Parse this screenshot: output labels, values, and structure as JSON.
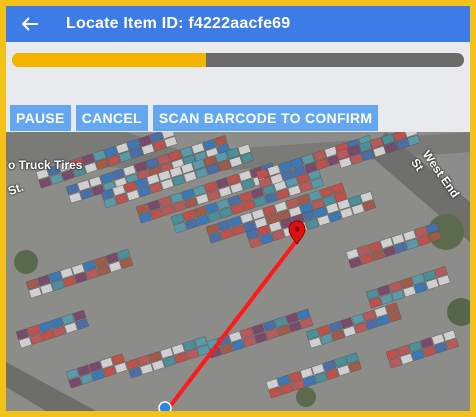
{
  "header": {
    "back_icon": "arrow-left-icon",
    "title": "Locate Item ID: f4222aacfe69"
  },
  "progress": {
    "value": 0.43,
    "fill_color": "#f4b400",
    "track_color": "#6b6b6b"
  },
  "toolbar": {
    "pause_label": "PAUSE",
    "cancel_label": "CANCEL",
    "scan_label": "SCAN BARCODE TO CONFIRM"
  },
  "map": {
    "type": "satellite",
    "labels": {
      "truck_tires": "o Truck Tires",
      "west_end": "West End St",
      "st": "St."
    },
    "target_pin_icon": "red-map-pin-icon",
    "user_location_icon": "blue-location-dot-icon",
    "route_color": "#ff1a1a"
  }
}
